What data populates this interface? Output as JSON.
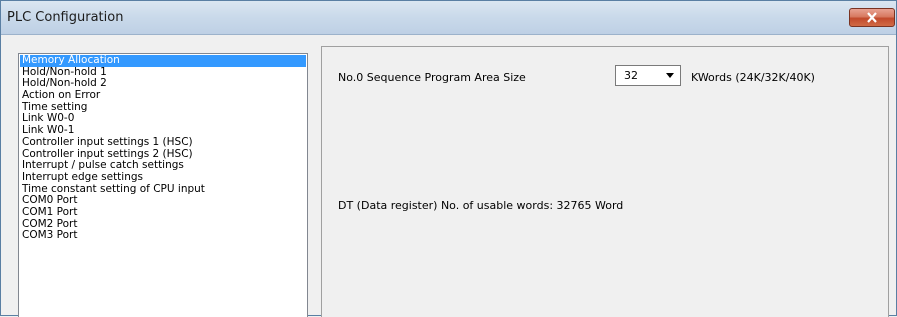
{
  "window": {
    "title": "PLC Configuration"
  },
  "sidebar": {
    "items": [
      {
        "label": "Memory Allocation",
        "selected": true
      },
      {
        "label": "Hold/Non-hold 1"
      },
      {
        "label": "Hold/Non-hold 2"
      },
      {
        "label": "Action on Error"
      },
      {
        "label": "Time setting"
      },
      {
        "label": "Link W0-0"
      },
      {
        "label": "Link W0-1"
      },
      {
        "label": "Controller input settings 1 (HSC)"
      },
      {
        "label": "Controller input settings 2 (HSC)"
      },
      {
        "label": "Interrupt / pulse catch settings"
      },
      {
        "label": "Interrupt edge settings"
      },
      {
        "label": "Time constant setting of CPU input"
      },
      {
        "label": "COM0 Port"
      },
      {
        "label": "COM1 Port"
      },
      {
        "label": "COM2 Port"
      },
      {
        "label": "COM3 Port"
      }
    ]
  },
  "main": {
    "sequence_label": "No.0 Sequence Program Area Size",
    "sequence_value": "32",
    "sequence_unit": "KWords  (24K/32K/40K)",
    "dt_label": "DT (Data register) No. of usable words:  32765 Word"
  },
  "colors": {
    "selection": "#3399ff",
    "close_button": "#c24a2c"
  }
}
